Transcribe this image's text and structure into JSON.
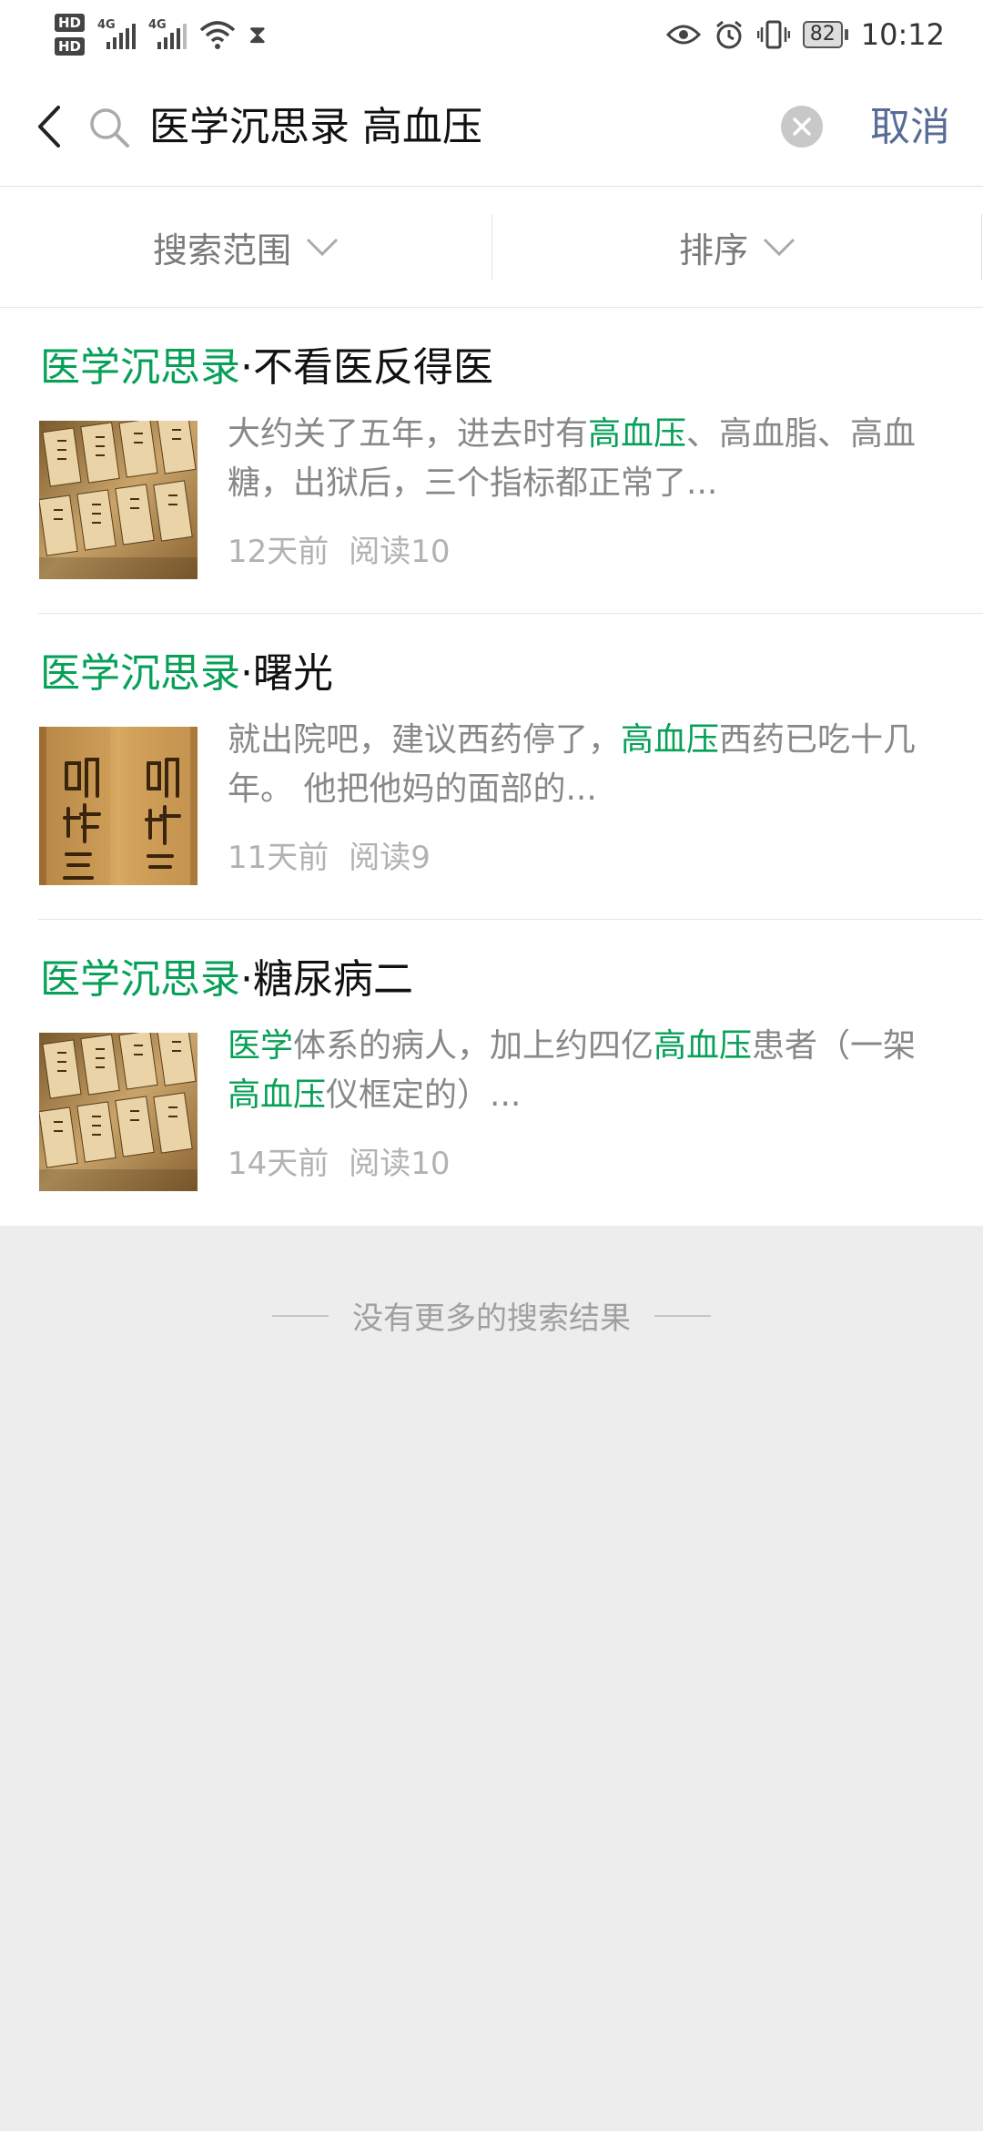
{
  "status_bar": {
    "hd1": "HD",
    "hd2": "HD",
    "net1": "4G",
    "net2": "4G",
    "battery": "82",
    "time": "10:12"
  },
  "search": {
    "query": "医学沉思录 高血压",
    "cancel_label": "取消"
  },
  "filters": {
    "scope_label": "搜索范围",
    "sort_label": "排序"
  },
  "results": [
    {
      "title_prefix": "医学沉思录",
      "title_rest": "·不看医反得医",
      "desc_parts": [
        {
          "t": "大约关了五年，进去时有",
          "h": false
        },
        {
          "t": "高血压",
          "h": true
        },
        {
          "t": "、高血脂、高血糖，出狱后，三个指标都正常了...",
          "h": false
        }
      ],
      "age": "12天前",
      "reads": "阅读10",
      "thumb": "bamboo-slips"
    },
    {
      "title_prefix": "医学沉思录",
      "title_rest": "·曙光",
      "desc_parts": [
        {
          "t": "就出院吧，建议西药停了，",
          "h": false
        },
        {
          "t": "高血压",
          "h": true
        },
        {
          "t": "西药已吃十几年。 他把他妈的面部的...",
          "h": false
        }
      ],
      "age": "11天前",
      "reads": "阅读9",
      "thumb": "ming-shi-san"
    },
    {
      "title_prefix": "医学沉思录",
      "title_rest": "·糖尿病二",
      "desc_parts": [
        {
          "t": "医学",
          "h": true
        },
        {
          "t": "体系的病人，加上约四亿",
          "h": false
        },
        {
          "t": "高血压",
          "h": true
        },
        {
          "t": "患者（一架",
          "h": false
        },
        {
          "t": "高血压",
          "h": true
        },
        {
          "t": "仪框定的）...",
          "h": false
        }
      ],
      "age": "14天前",
      "reads": "阅读10",
      "thumb": "bamboo-slips"
    }
  ],
  "footer": {
    "no_more": "没有更多的搜索结果"
  },
  "colors": {
    "highlight": "#07a057",
    "cancel": "#576b95",
    "background": "#ededed"
  }
}
